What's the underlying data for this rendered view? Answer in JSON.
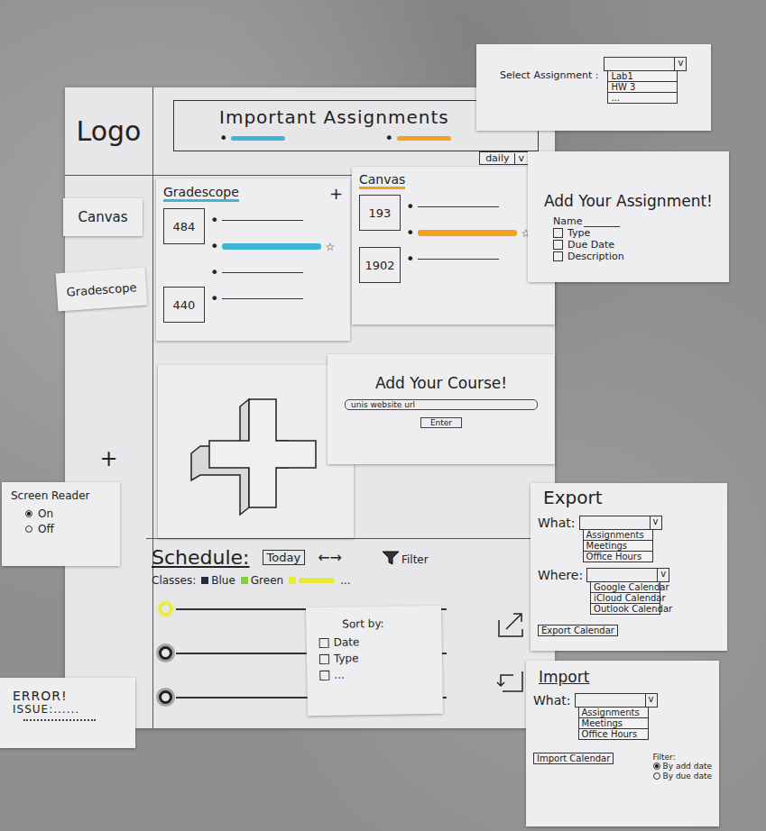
{
  "logo": "Logo",
  "header": {
    "title": "Important Assignments",
    "legend": [
      {
        "bullet": "•",
        "color": "#3fb6d8"
      },
      {
        "bullet": "•",
        "color": "#f5a01f"
      }
    ],
    "dropdown": {
      "value": "daily",
      "toggle": "v"
    }
  },
  "select_assignment": {
    "label": "Select Assignment :",
    "toggle": "v",
    "options": [
      "Lab1",
      "HW 3",
      "..."
    ]
  },
  "sidebar": {
    "items": [
      {
        "label": "Canvas"
      },
      {
        "label": "Gradescope"
      }
    ],
    "add": "+"
  },
  "course_cards": [
    {
      "title": "Gradescope",
      "color": "#3fb6d8",
      "add": "+",
      "groups": [
        {
          "code": "484",
          "rows": [
            {
              "bullet": "•",
              "highlighted": false
            },
            {
              "bullet": "•",
              "highlighted": true,
              "star": "☆"
            },
            {
              "bullet": "•",
              "highlighted": false
            }
          ]
        },
        {
          "code": "440",
          "rows": [
            {
              "bullet": "•",
              "highlighted": false
            }
          ]
        }
      ]
    },
    {
      "title": "Canvas",
      "color": "#f5a01f",
      "groups": [
        {
          "code": "193",
          "rows": [
            {
              "bullet": "•",
              "highlighted": false
            },
            {
              "bullet": "•",
              "highlighted": true,
              "star": "☆"
            }
          ]
        },
        {
          "code": "1902",
          "rows": [
            {
              "bullet": "•",
              "highlighted": false
            }
          ]
        }
      ]
    }
  ],
  "add_assignment": {
    "title": "Add Your Assignment!",
    "name_label": "Name",
    "fields": [
      {
        "label": "Type",
        "checked": false
      },
      {
        "label": "Due Date",
        "checked": false
      },
      {
        "label": "Description",
        "checked": false
      }
    ]
  },
  "add_course": {
    "title": "Add Your Course!",
    "placeholder": "unis website url",
    "button": "Enter"
  },
  "screen_reader": {
    "title": "Screen Reader",
    "options": [
      {
        "label": "On",
        "selected": true
      },
      {
        "label": "Off",
        "selected": false
      }
    ]
  },
  "error": {
    "title": "ERROR!",
    "issue": "ISSUE:......"
  },
  "schedule": {
    "title": "Schedule:",
    "today": "Today",
    "nav": "←→",
    "filter": "Filter",
    "classes_label": "Classes:",
    "classes": [
      {
        "label": "Blue",
        "color": "#2a2a3a"
      },
      {
        "label": "Green",
        "color": "#7fd13b"
      },
      {
        "label": "",
        "color": "#e6ea3a"
      }
    ],
    "more": "...",
    "rows": [
      {
        "color": "#e6ea3a"
      },
      {
        "color": "#222222"
      },
      {
        "color": "#222222"
      }
    ]
  },
  "sort": {
    "title": "Sort by:",
    "options": [
      {
        "label": "Date",
        "checked": false
      },
      {
        "label": "Type",
        "checked": false
      },
      {
        "label": "...",
        "checked": false
      }
    ]
  },
  "export": {
    "title": "Export",
    "what": {
      "label": "What:",
      "toggle": "v",
      "options": [
        "Assignments",
        "Meetings",
        "Office Hours"
      ]
    },
    "where": {
      "label": "Where:",
      "toggle": "v",
      "options": [
        "Google Calendar",
        "iCloud Calendar",
        "Outlook Calendar"
      ]
    },
    "button": "Export Calendar"
  },
  "import": {
    "title": "Import",
    "what": {
      "label": "What:",
      "toggle": "v",
      "options": [
        "Assignments",
        "Meetings",
        "Office Hours"
      ]
    },
    "button": "Import Calendar",
    "filter": {
      "label": "Filter:",
      "options": [
        {
          "label": "By add date",
          "selected": true
        },
        {
          "label": "By due date",
          "selected": false
        }
      ]
    }
  }
}
